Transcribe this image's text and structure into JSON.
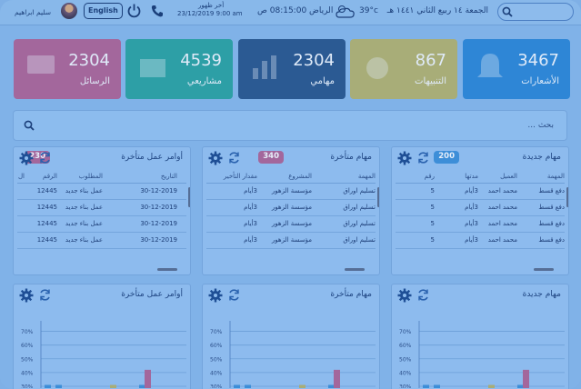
{
  "topbar": {
    "date_hijri": "الجمعة ١٤ ربيع الثاني ١٤٤١ هـ",
    "temperature": "39°c",
    "city_time": "الرياض 08:15:00 ص",
    "last_seen_label": "أخر ظهور",
    "last_seen_value": "23/12/2019 9:00 am",
    "language_label": "English",
    "user_name": "سليم ابراهيم"
  },
  "stats": [
    {
      "value": "3467",
      "label": "الأشعارات",
      "color": "#2e86d6"
    },
    {
      "value": "867",
      "label": "التنبيهات",
      "color": "#a8ad78"
    },
    {
      "value": "2304",
      "label": "مهامي",
      "color": "#2b5a93"
    },
    {
      "value": "4539",
      "label": "مشاريعي",
      "color": "#2d9fa6"
    },
    {
      "value": "2304",
      "label": "الرسائل",
      "color": "#a3679c"
    }
  ],
  "search": {
    "placeholder": "بحث ..."
  },
  "panels": [
    {
      "title": "مهام جديدة",
      "count": "200",
      "badge_color": "#3d8ed8",
      "columns": [
        "المهمة",
        "العميل",
        "مدتها",
        "رقم"
      ],
      "rows": [
        [
          "دفع قسط",
          "محمد احمد",
          "3أيام",
          "5"
        ],
        [
          "دفع قسط",
          "محمد احمد",
          "3أيام",
          "5"
        ],
        [
          "دفع قسط",
          "محمد احمد",
          "3أيام",
          "5"
        ],
        [
          "دفع قسط",
          "محمد احمد",
          "3أيام",
          "5"
        ]
      ]
    },
    {
      "title": "مهام متأخرة",
      "count": "340",
      "badge_color": "#a3679c",
      "columns": [
        "المهمة",
        "المشروع",
        "مقدار التأخير"
      ],
      "rows": [
        [
          "تسليم اوراق",
          "مؤسسة الزهور",
          "3أيام"
        ],
        [
          "تسليم اوراق",
          "مؤسسة الزهور",
          "3أيام"
        ],
        [
          "تسليم اوراق",
          "مؤسسة الزهور",
          "3أيام"
        ],
        [
          "تسليم اوراق",
          "مؤسسة الزهور",
          "3أيام"
        ]
      ]
    },
    {
      "title": "أوامر عمل متأخرة",
      "count": "230",
      "badge_color": "#a3679c",
      "columns": [
        "ال",
        "الرقم",
        "المطلوب",
        "التاريخ"
      ],
      "rows": [
        [
          "",
          "12445",
          "عمل بناء جديد",
          "30-12-2019"
        ],
        [
          "",
          "12445",
          "عمل بناء جديد",
          "30-12-2019"
        ],
        [
          "",
          "12445",
          "عمل بناء جديد",
          "30-12-2019"
        ],
        [
          "",
          "12445",
          "عمل بناء جديد",
          "30-12-2019"
        ]
      ]
    }
  ],
  "chart_panels": [
    {
      "title": "مهام جديدة"
    },
    {
      "title": "مهام متأخرة"
    },
    {
      "title": "أوامر عمل متأخرة"
    }
  ],
  "chart_data": [
    {
      "type": "bar",
      "yticks": [
        "70%",
        "60%",
        "50%",
        "40%",
        "30%"
      ],
      "ylim": [
        30,
        75
      ],
      "values": [
        31,
        31,
        31,
        31,
        42
      ],
      "colors": [
        "#3d8ed8",
        "#3d8ed8",
        "#a8ad78",
        "#3d8ed8",
        "#a3679c"
      ]
    },
    {
      "type": "bar",
      "yticks": [
        "70%",
        "60%",
        "50%",
        "40%",
        "30%"
      ],
      "ylim": [
        30,
        75
      ],
      "values": [
        31,
        31,
        31,
        31,
        42
      ],
      "colors": [
        "#3d8ed8",
        "#3d8ed8",
        "#a8ad78",
        "#3d8ed8",
        "#a3679c"
      ]
    },
    {
      "type": "bar",
      "yticks": [
        "70%",
        "60%",
        "50%",
        "40%",
        "30%"
      ],
      "ylim": [
        30,
        75
      ],
      "values": [
        31,
        31,
        31,
        31,
        42
      ],
      "colors": [
        "#3d8ed8",
        "#3d8ed8",
        "#a8ad78",
        "#3d8ed8",
        "#a3679c"
      ]
    }
  ]
}
